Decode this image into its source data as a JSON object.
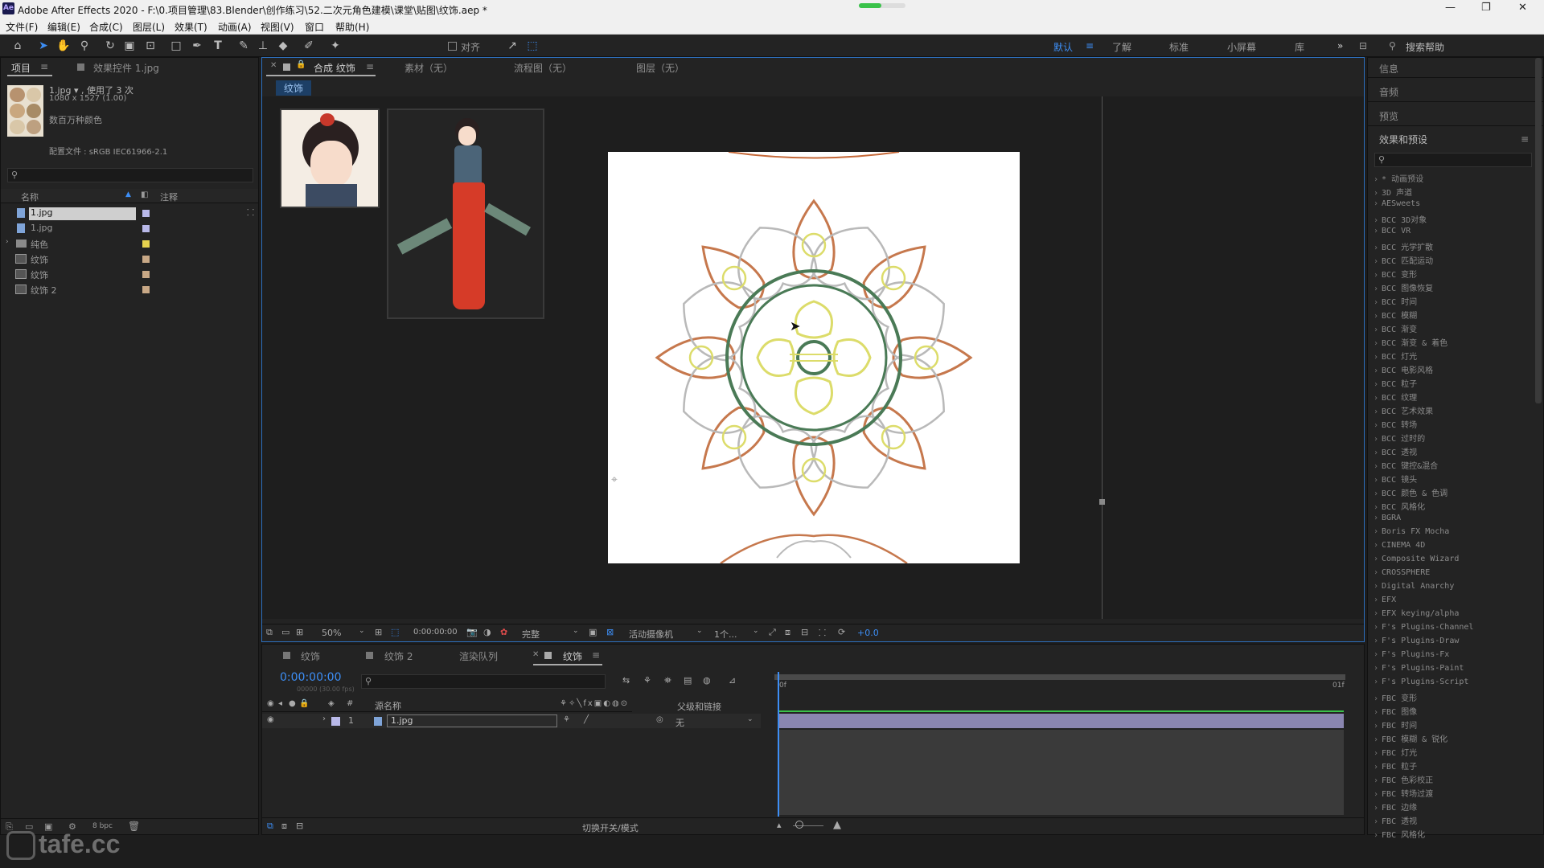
{
  "window": {
    "title": "Adobe After Effects 2020 - F:\\0.项目管理\\83.Blender\\创作练习\\52.二次元角色建模\\课堂\\贴图\\纹饰.aep *",
    "app_icon": "Ae",
    "minimize": "—",
    "restore": "❐",
    "close": "✕"
  },
  "menu": [
    "文件(F)",
    "编辑(E)",
    "合成(C)",
    "图层(L)",
    "效果(T)",
    "动画(A)",
    "视图(V)",
    "窗口",
    "帮助(H)"
  ],
  "toolbar": {
    "align_label": "对齐",
    "workspaces": [
      "默认",
      "了解",
      "标准",
      "小屏幕",
      "库"
    ],
    "active_workspace": "默认",
    "search_placeholder": "搜索帮助",
    "more": "»"
  },
  "project": {
    "tab": "项目",
    "effects_tab": "效果控件 1.jpg",
    "item_name": "1.jpg ▾ , 使用了 3 次",
    "item_dims": "1080 x 1527 (1.00)",
    "item_colors": "数百万种颜色",
    "profile": "配置文件 : sRGB IEC61966-2.1",
    "col_name": "名称",
    "col_comment": "注释",
    "bpc": "8 bpc",
    "items": [
      {
        "name": "1.jpg",
        "type": "image",
        "color": "#b9b9e9",
        "selected": true
      },
      {
        "name": "1.jpg",
        "type": "image",
        "color": "#b9b9e9"
      },
      {
        "name": "纯色",
        "type": "folder",
        "color": "#e6d24e"
      },
      {
        "name": "纹饰",
        "type": "comp",
        "color": "#c8a886"
      },
      {
        "name": "纹饰",
        "type": "comp",
        "color": "#c8a886"
      },
      {
        "name": "纹饰 2",
        "type": "comp",
        "color": "#c8a886"
      }
    ]
  },
  "viewer": {
    "comp_tab": "合成 纹饰",
    "tabs": [
      "素材（无）",
      "流程图（无）",
      "图层（无）"
    ],
    "breadcrumb": "纹饰",
    "zoom": "50%",
    "time": "0:00:00:00",
    "quality": "完整",
    "camera": "活动摄像机",
    "views": "1个...",
    "exposure": "+0.0"
  },
  "timeline": {
    "tabs": [
      "纹饰",
      "纹饰 2",
      "渲染队列",
      "纹饰"
    ],
    "timecode": "0:00:00:00",
    "frames": "00000 (30.00 fps)",
    "col_source": "源名称",
    "col_parent": "父级和链接",
    "ruler_start": "0f",
    "ruler_end": "01f",
    "toggle_label": "切换开关/模式",
    "layers": [
      {
        "index": "1",
        "name": "1.jpg",
        "parent": "无"
      }
    ]
  },
  "right": {
    "info": "信息",
    "audio": "音频",
    "preview": "预览",
    "effects_title": "效果和预设",
    "search_placeholder": "",
    "effects": [
      "* 动画预设",
      "3D 声道",
      "AESweets",
      "BCC 3D对象",
      "BCC VR",
      "BCC 光学扩散",
      "BCC 匹配运动",
      "BCC 变形",
      "BCC 图像恢复",
      "BCC 时间",
      "BCC 模糊",
      "BCC 渐变",
      "BCC 渐变 & 着色",
      "BCC 灯光",
      "BCC 电影风格",
      "BCC 粒子",
      "BCC 纹理",
      "BCC 艺术效果",
      "BCC 转场",
      "BCC 过时的",
      "BCC 透视",
      "BCC 键控&混合",
      "BCC 镜头",
      "BCC 颜色 & 色调",
      "BCC 风格化",
      "BGRA",
      "Boris FX Mocha",
      "CINEMA 4D",
      "Composite Wizard",
      "CROSSPHERE",
      "Digital Anarchy",
      "EFX",
      "EFX keying/alpha",
      "F's Plugins-Channel",
      "F's Plugins-Draw",
      "F's Plugins-Fx",
      "F's Plugins-Paint",
      "F's Plugins-Script",
      "FBC 变形",
      "FBC 图像",
      "FBC 时间",
      "FBC 模糊 & 锐化",
      "FBC 灯光",
      "FBC 粒子",
      "FBC 色彩校正",
      "FBC 转场过渡",
      "FBC 边缘",
      "FBC 透视",
      "FBC 风格化"
    ]
  },
  "watermark": "tafe.cc"
}
